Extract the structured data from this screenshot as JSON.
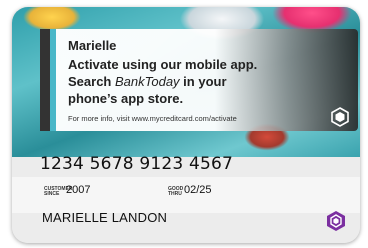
{
  "banner": {
    "name": "Marielle",
    "line1": "Activate using our mobile app.",
    "line2_prefix": "Search ",
    "app_name": "BankToday",
    "line2_suffix": " in your",
    "line3": "phone’s app store.",
    "more_info": "For more info, visit www.mycreditcard.com/activate"
  },
  "card": {
    "number": "1234 5678 9123 4567",
    "since_label_line1": "CUSTOMER",
    "since_label_line2": "SINCE",
    "since_value": "2007",
    "thru_label_line1": "GOOD",
    "thru_label_line2": "THRU",
    "thru_value": "02/25",
    "holder": "MARIELLE  LANDON"
  },
  "colors": {
    "accent_teal": "#49b7c8",
    "logo_purple": "#7b2fa0",
    "bar_dark": "#333333"
  },
  "icons": {
    "banner_logo": "bank-logo-icon",
    "card_logo": "card-network-logo-icon"
  }
}
